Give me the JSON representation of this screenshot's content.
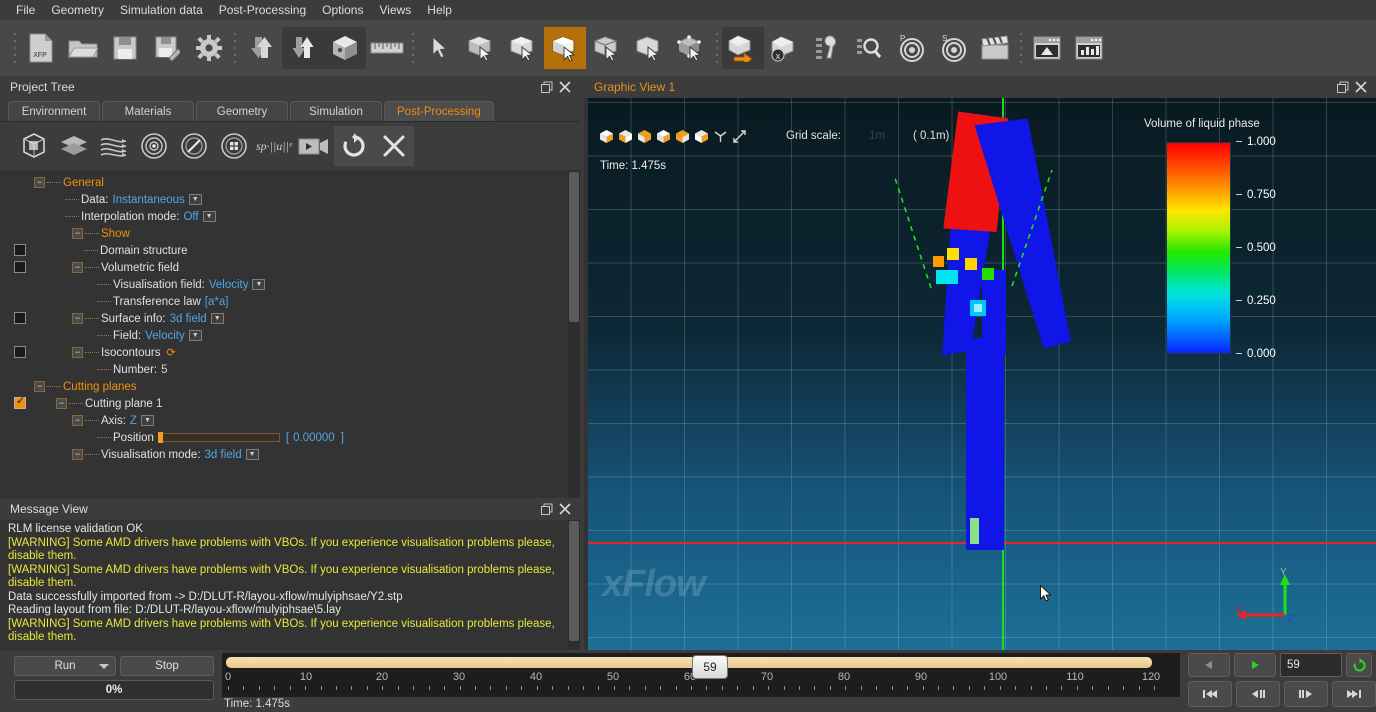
{
  "menubar": {
    "items": [
      {
        "label": "File"
      },
      {
        "label": "Geometry"
      },
      {
        "label": "Simulation data"
      },
      {
        "label": "Post-Processing"
      },
      {
        "label": "Options"
      },
      {
        "label": "Views"
      },
      {
        "label": "Help"
      }
    ]
  },
  "toolbar": {
    "buttons": [
      {
        "name": "new-project-xfp-icon",
        "title": "New project"
      },
      {
        "name": "open-folder-icon",
        "title": "Open"
      },
      {
        "name": "save-floppy-icon",
        "title": "Save"
      },
      {
        "name": "save-as-floppy-icon",
        "title": "Save as"
      },
      {
        "name": "settings-gear-icon",
        "title": "Settings"
      },
      {
        "name": "import-down-arrow-icon",
        "title": "Import"
      },
      {
        "name": "import-export-arrows-icon",
        "title": "Import/Export"
      },
      {
        "name": "geometry-cube-icon",
        "title": "Geometry"
      },
      {
        "name": "ruler-measure-icon",
        "title": "Measure"
      },
      {
        "name": "select-pointer-icon",
        "title": "Select"
      },
      {
        "name": "select-face-cube-icon",
        "title": "Select face"
      },
      {
        "name": "select-edge-cube-icon",
        "title": "Select edge"
      },
      {
        "name": "select-body-cube-icon",
        "title": "Select body"
      },
      {
        "name": "select-volume-cube-icon",
        "title": "Select volume"
      },
      {
        "name": "select-solid-cube-icon",
        "title": "Select solid"
      },
      {
        "name": "select-vertex-cube-icon",
        "title": "Select vertex"
      },
      {
        "name": "move-geometry-icon",
        "title": "Move geometry"
      },
      {
        "name": "delete-geometry-icon",
        "title": "Delete geometry"
      },
      {
        "name": "tools-wrench-icon",
        "title": "Tools"
      },
      {
        "name": "zoom-inspect-icon",
        "title": "Inspect"
      },
      {
        "name": "primary-target-icon",
        "title": "Primary target"
      },
      {
        "name": "secondary-target-icon",
        "title": "Secondary target"
      },
      {
        "name": "movie-clapper-icon",
        "title": "Animation"
      },
      {
        "name": "graphic-view-window-icon",
        "title": "Graphic view"
      },
      {
        "name": "plot-view-window-icon",
        "title": "Plot view"
      }
    ]
  },
  "project_tree": {
    "panel_title": "Project Tree",
    "restore_icon": "restore-icon",
    "close_icon": "close-icon",
    "tabs": [
      {
        "label": "Environment",
        "active": false
      },
      {
        "label": "Materials",
        "active": false
      },
      {
        "label": "Geometry",
        "active": false
      },
      {
        "label": "Simulation",
        "active": false
      },
      {
        "label": "Post-Processing",
        "active": true
      }
    ],
    "tools": [
      {
        "name": "domain-box-icon"
      },
      {
        "name": "layers-surface-icon"
      },
      {
        "name": "streamlines-icon"
      },
      {
        "name": "vortex-rings-icon"
      },
      {
        "name": "no-display-icon"
      },
      {
        "name": "volume-render-icon"
      },
      {
        "name": "sp-norm-u-icon",
        "label": "sp·||u||ᵉ"
      },
      {
        "name": "video-camera-icon"
      },
      {
        "name": "refresh-icon"
      },
      {
        "name": "close-x-icon"
      }
    ],
    "nodes": [
      {
        "label": "General",
        "kind": "category",
        "expander": "-"
      },
      {
        "label": "Data:",
        "value": "Instantaneous",
        "dropdown": true
      },
      {
        "label": "Interpolation mode:",
        "value": "Off",
        "dropdown": true
      },
      {
        "label": "Show",
        "kind": "category",
        "expander": "-"
      },
      {
        "label": "Domain structure",
        "checkbox": "unchecked"
      },
      {
        "label": "Volumetric field",
        "checkbox": "unchecked",
        "expander": "-"
      },
      {
        "label": "Visualisation field:",
        "value": "Velocity",
        "dropdown": true
      },
      {
        "label": "Transference law",
        "value": "[a*a]"
      },
      {
        "label": "Surface info:",
        "value": "3d field",
        "dropdown": true,
        "checkbox": "unchecked",
        "expander": "-"
      },
      {
        "label": "Field:",
        "value": "Velocity",
        "dropdown": true
      },
      {
        "label": "Isocontours",
        "checkbox": "unchecked",
        "expander": "-",
        "refresh": true
      },
      {
        "label": "Number:",
        "value": "5",
        "plain": true
      },
      {
        "label": "Cutting planes",
        "kind": "category",
        "expander": "-"
      },
      {
        "label": "Cutting plane 1",
        "checkbox": "checked",
        "expander": "-"
      },
      {
        "label": "Axis:",
        "value": "Z",
        "dropdown": true,
        "expander": "-"
      },
      {
        "label": "Position",
        "slider": true,
        "bracket_value": "0.00000"
      },
      {
        "label": "Visualisation mode:",
        "value": "3d field",
        "dropdown": true,
        "expander": "-"
      }
    ]
  },
  "message_view": {
    "panel_title": "Message View",
    "restore_icon": "restore-icon",
    "close_icon": "close-icon",
    "lines": [
      {
        "text": "RLM license validation OK",
        "type": "info"
      },
      {
        "text": "[WARNING] Some AMD drivers have problems with VBOs. If you experience visualisation problems please, disable them.",
        "type": "warn"
      },
      {
        "text": "[WARNING] Some AMD drivers have problems with VBOs. If you experience visualisation problems please, disable them.",
        "type": "warn"
      },
      {
        "text": "Data successfully imported from -> D:/DLUT-R/layou-xflow/mulyiphsae/Y2.stp",
        "type": "info"
      },
      {
        "text": "Reading layout from file: D:/DLUT-R/layou-xflow/mulyiphsae\\5.lay",
        "type": "info"
      },
      {
        "text": "[WARNING] Some AMD drivers have problems with VBOs. If you experience visualisation problems please, disable them.",
        "type": "warn"
      }
    ]
  },
  "graphic_view": {
    "panel_title": "Graphic View 1",
    "restore_icon": "restore-icon",
    "close_icon": "close-icon",
    "view_buttons": [
      {
        "name": "view-isometric-icon"
      },
      {
        "name": "view-front-icon"
      },
      {
        "name": "view-side-icon"
      },
      {
        "name": "view-top-icon"
      },
      {
        "name": "view-bottom-icon"
      },
      {
        "name": "view-back-icon"
      },
      {
        "name": "view-axis-triad-icon"
      },
      {
        "name": "view-fit-icon"
      }
    ],
    "grid_scale_label": "Grid scale:",
    "grid_scale_faint": "1m",
    "grid_scale_value": "( 0.1m)",
    "time_label": "Time: 1.475s",
    "watermark": "xFlow",
    "legend": {
      "title": "Volume of liquid phase",
      "ticks": [
        "1.000",
        "0.750",
        "0.500",
        "0.250",
        "0.000"
      ]
    },
    "triad": {
      "y_label": "Y",
      "x_label": "X",
      "z_label": "Z",
      "y_color": "#19e019",
      "x_color": "#e02a2a",
      "z_color": "#2b3ae8"
    }
  },
  "bottom_bar": {
    "run_label": "Run",
    "stop_label": "Stop",
    "progress_label": "0%",
    "time_label": "Time: 1.475s",
    "timeline": {
      "ticks": [
        "0",
        "10",
        "20",
        "30",
        "40",
        "50",
        "60",
        "70",
        "80",
        "90",
        "100",
        "110",
        "120"
      ],
      "handle_value": "59",
      "min": 0,
      "max": 120,
      "current": 59
    },
    "playback": {
      "prev_label": "◀",
      "play_label": "▶",
      "frame_value": "59",
      "loop_icon": "loop-icon",
      "first_label": "⏮",
      "step_back_label": "◀❙",
      "step_fwd_label": "❙▶",
      "last_label": "⏭"
    }
  },
  "colors": {
    "accent": "#f0900f",
    "value_blue": "#4ea6e8",
    "warn_yellow": "#e8e83c",
    "panel_bg": "#3c3c3c",
    "viewport_bg": "#0d2836"
  }
}
